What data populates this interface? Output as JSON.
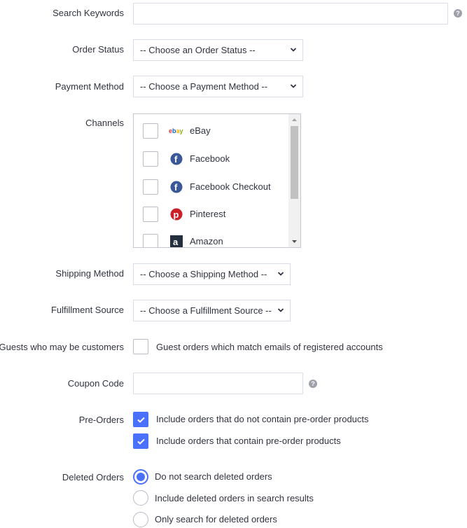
{
  "search": {
    "label": "Search Keywords",
    "value": "",
    "placeholder": "",
    "help_icon": "question-circle-icon",
    "help_glyph": "?"
  },
  "order_status": {
    "label": "Order Status",
    "selected": "-- Choose an Order Status --"
  },
  "payment_method": {
    "label": "Payment Method",
    "selected": "-- Choose a Payment Method --"
  },
  "channels": {
    "label": "Channels",
    "items": [
      {
        "name": "eBay",
        "icon": "ebay-logo-icon",
        "checked": false
      },
      {
        "name": "Facebook",
        "icon": "facebook-icon",
        "checked": false
      },
      {
        "name": "Facebook Checkout",
        "icon": "facebook-icon",
        "checked": false
      },
      {
        "name": "Pinterest",
        "icon": "pinterest-icon",
        "checked": false
      },
      {
        "name": "Amazon",
        "icon": "amazon-icon",
        "checked": false
      }
    ]
  },
  "shipping_method": {
    "label": "Shipping Method",
    "selected": "-- Choose a Shipping Method --"
  },
  "fulfillment_source": {
    "label": "Fulfillment Source",
    "selected": "-- Choose a Fulfillment Source --"
  },
  "guests": {
    "label": "Guests who may be customers",
    "option": "Guest orders which match emails of registered accounts",
    "checked": false
  },
  "coupon": {
    "label": "Coupon Code",
    "value": "",
    "help_glyph": "?"
  },
  "pre_orders": {
    "label": "Pre-Orders",
    "options": [
      {
        "text": "Include orders that do not contain pre-order products",
        "checked": true
      },
      {
        "text": "Include orders that contain pre-order products",
        "checked": true
      }
    ]
  },
  "deleted_orders": {
    "label": "Deleted Orders",
    "options": [
      {
        "text": "Do not search deleted orders",
        "selected": true
      },
      {
        "text": "Include deleted orders in search results",
        "selected": false
      },
      {
        "text": "Only search for deleted orders",
        "selected": false
      }
    ]
  },
  "colors": {
    "accent": "#4b71fc",
    "text": "#313440",
    "border": "#d9dce9"
  }
}
